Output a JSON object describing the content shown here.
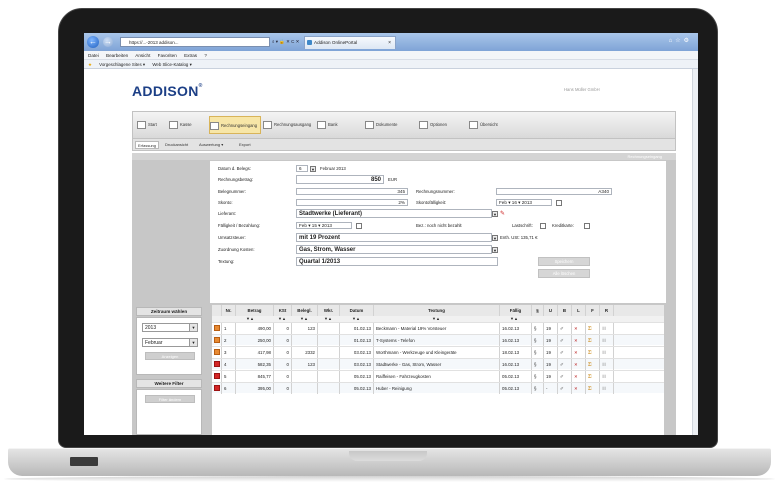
{
  "browser": {
    "address": "https://...-2013 addison...",
    "address_controls": "⌕ ▾ 🔒 ✕ C ✕",
    "tab_title": "Addison OnlinePortal",
    "tab_close": "×",
    "menu": [
      "Datei",
      "Bearbeiten",
      "Ansicht",
      "Favoriten",
      "Extras",
      "?"
    ],
    "favorites": [
      "Vorgeschlagene Sites ▾",
      "Web Slice-Katalog ▾"
    ]
  },
  "app": {
    "logo": "ADDISON",
    "logo_mark": "®",
    "user": "Hans Müller GmbH",
    "ribbon": [
      {
        "label": "Start",
        "active": false
      },
      {
        "label": "Kasse",
        "active": false
      },
      {
        "label": "Rechnungseingang",
        "active": true
      },
      {
        "label": "Rechnungsausgang",
        "active": false
      },
      {
        "label": "Bank",
        "active": false
      },
      {
        "label": "Dokumente",
        "active": false
      },
      {
        "label": "Optionen",
        "active": false
      },
      {
        "label": "Übersicht",
        "active": false
      }
    ],
    "subtabs": [
      "Erfassung",
      "Druckansicht",
      "Auswertung ▾",
      "Export"
    ],
    "form_header": "Rechnungseingang"
  },
  "form": {
    "datum_label": "Datum d. Belegs:",
    "datum_day": "6",
    "datum_month": "Februar 2013",
    "betrag_label": "Rechnungsbetrag:",
    "betrag_value": "850",
    "betrag_unit": "EUR",
    "belegnr_label": "Belegnummer:",
    "belegnr_value": "345",
    "rechnr_label": "Rechnungsnummer:",
    "rechnr_value": "A340",
    "skonto_label": "Skonto:",
    "skonto_value": "2%",
    "skontofaellig_label": "Skontofälligkeit:",
    "skontofaellig_value": "Feb ▾ 16 ▾ 2013",
    "lieferant_label": "Lieferant:",
    "lieferant_value": "Stadtwerke (Lieferant)",
    "faellig_label": "Fälligkeit / Bezahlung:",
    "faellig_value": "Feb ▾ 15 ▾ 2013",
    "bez_label": "Bez.: noch nicht bezahlt",
    "lastschrift_label": "Lastschrift:",
    "kreditkarte_label": "Kreditkarte:",
    "ust_label": "Umsatzsteuer:",
    "ust_value": "mit 19 Prozent",
    "ust_info": "Enth. USt: 135,71 €",
    "kosten_label": "Zuordnung Kosten:",
    "kosten_value": "Gas, Strom, Wasser",
    "text_label": "Textung:",
    "text_value": "Quartal 1/2013",
    "btn_save": "Speichern",
    "btn_new": "Alle löschen"
  },
  "sidebar": {
    "zeitraum_title": "Zeitraum wählen",
    "year": "2013",
    "month": "Februar",
    "apply": "Anzeigen",
    "filter_title": "Weitere Filter",
    "filter_btn": "Filter ändern"
  },
  "table": {
    "headers": [
      "",
      "Nr.",
      "Betrag",
      "KSt",
      "Belegl.",
      "Wkr.",
      "Datum",
      "Textung",
      "Fällig",
      "§",
      "U",
      "B",
      "L",
      "F",
      "R"
    ],
    "sort_arrows": "▼▲",
    "rows": [
      {
        "nr": "1",
        "betrag": "490,00",
        "kst": "0",
        "beleg": "123",
        "wkr": "",
        "datum": "01.02.13",
        "text": "Beckmann - Material 19% Vorsteuer",
        "faellig": "16.02.13",
        "u": "19",
        "mark": "orange"
      },
      {
        "nr": "2",
        "betrag": "250,00",
        "kst": "0",
        "beleg": "",
        "wkr": "",
        "datum": "01.02.13",
        "text": "T-Systems - Telefon",
        "faellig": "16.02.13",
        "u": "19",
        "mark": "orange"
      },
      {
        "nr": "3",
        "betrag": "417,98",
        "kst": "0",
        "beleg": "2332",
        "wkr": "",
        "datum": "03.02.13",
        "text": "Worthmann - Werkzeuge und Kleingeräte",
        "faellig": "18.02.13",
        "u": "19",
        "mark": "orange"
      },
      {
        "nr": "4",
        "betrag": "582,35",
        "kst": "0",
        "beleg": "123",
        "wkr": "",
        "datum": "03.02.13",
        "text": "Stadtwerke - Gas, Strom, Wasser",
        "faellig": "16.02.13",
        "u": "19",
        "mark": "red"
      },
      {
        "nr": "5",
        "betrag": "845,77",
        "kst": "0",
        "beleg": "",
        "wkr": "",
        "datum": "05.02.13",
        "text": "Raiffeisen - Fahrzeugkosten",
        "faellig": "05.02.13",
        "u": "19",
        "mark": "red"
      },
      {
        "nr": "6",
        "betrag": "395,00",
        "kst": "0",
        "beleg": "",
        "wkr": "",
        "datum": "05.02.13",
        "text": "Huber - Reinigung",
        "faellig": "05.02.13",
        "u": "-",
        "mark": "red"
      }
    ]
  },
  "colors": {
    "brand": "#1c3f86",
    "active_tab": "#f7e6a7",
    "mark_orange": "#e88a32",
    "mark_red": "#d42626"
  }
}
